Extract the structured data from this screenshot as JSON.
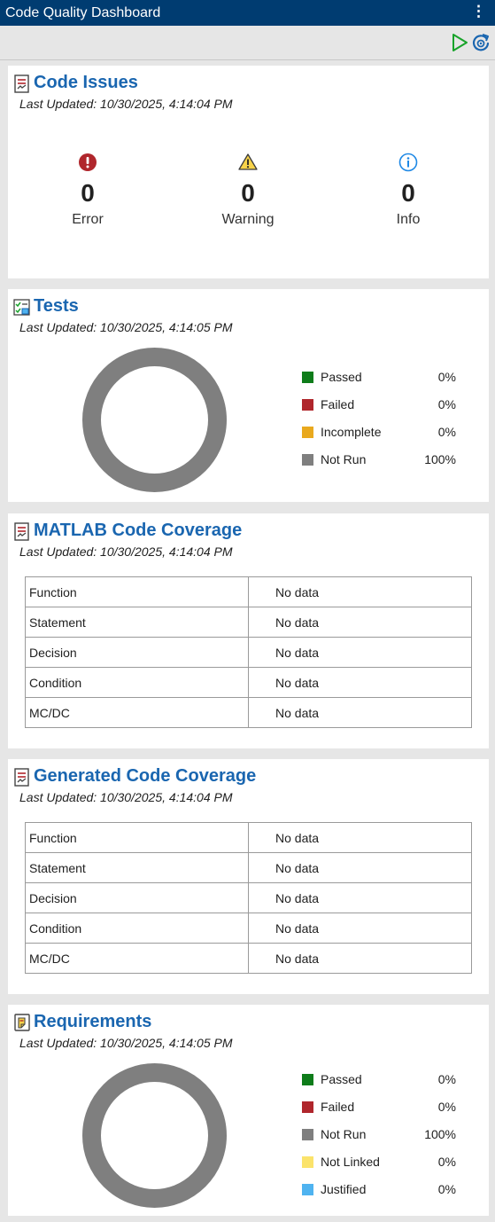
{
  "window": {
    "title": "Code Quality Dashboard"
  },
  "toolbar": {
    "run_icon": "run-icon",
    "refresh_icon": "refresh-icon"
  },
  "code_issues": {
    "title": "Code Issues",
    "updated": "Last Updated: 10/30/2025, 4:14:04 PM",
    "items": [
      {
        "count": "0",
        "label": "Error",
        "icon": "error-icon",
        "color": "#b0262c"
      },
      {
        "count": "0",
        "label": "Warning",
        "icon": "warning-icon",
        "color": "#e7b416"
      },
      {
        "count": "0",
        "label": "Info",
        "icon": "info-icon",
        "color": "#1e88e5"
      }
    ]
  },
  "tests": {
    "title": "Tests",
    "updated": "Last Updated: 10/30/2025, 4:14:05 PM",
    "legend": [
      {
        "name": "Passed",
        "pct": "0%",
        "color": "#0e7c1a"
      },
      {
        "name": "Failed",
        "pct": "0%",
        "color": "#b0262c"
      },
      {
        "name": "Incomplete",
        "pct": "0%",
        "color": "#e9a91e"
      },
      {
        "name": "Not Run",
        "pct": "100%",
        "color": "#7f7f7f"
      }
    ]
  },
  "matlab_coverage": {
    "title": "MATLAB Code Coverage",
    "updated": "Last Updated: 10/30/2025, 4:14:04 PM",
    "rows": [
      {
        "metric": "Function",
        "value": "No data"
      },
      {
        "metric": "Statement",
        "value": "No data"
      },
      {
        "metric": "Decision",
        "value": "No data"
      },
      {
        "metric": "Condition",
        "value": "No data"
      },
      {
        "metric": "MC/DC",
        "value": "No data"
      }
    ]
  },
  "generated_coverage": {
    "title": "Generated Code Coverage",
    "updated": "Last Updated: 10/30/2025, 4:14:04 PM",
    "rows": [
      {
        "metric": "Function",
        "value": "No data"
      },
      {
        "metric": "Statement",
        "value": "No data"
      },
      {
        "metric": "Decision",
        "value": "No data"
      },
      {
        "metric": "Condition",
        "value": "No data"
      },
      {
        "metric": "MC/DC",
        "value": "No data"
      }
    ]
  },
  "requirements": {
    "title": "Requirements",
    "updated": "Last Updated: 10/30/2025, 4:14:05 PM",
    "legend": [
      {
        "name": "Passed",
        "pct": "0%",
        "color": "#0e7c1a"
      },
      {
        "name": "Failed",
        "pct": "0%",
        "color": "#b0262c"
      },
      {
        "name": "Not Run",
        "pct": "100%",
        "color": "#7f7f7f"
      },
      {
        "name": "Not Linked",
        "pct": "0%",
        "color": "#fbe36b"
      },
      {
        "name": "Justified",
        "pct": "0%",
        "color": "#4fb3f0"
      }
    ]
  },
  "colors": {
    "title_bar": "#003c71",
    "link_title": "#1a66b0",
    "donut": "#7f7f7f"
  }
}
